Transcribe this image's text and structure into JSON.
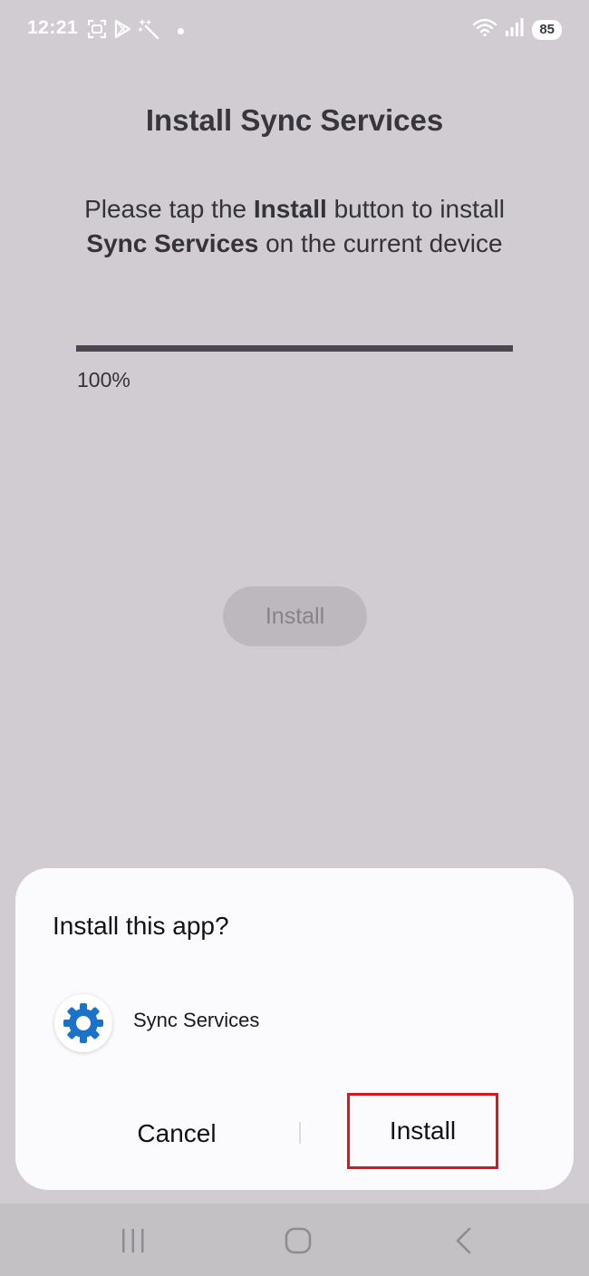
{
  "status_bar": {
    "time": "12:21",
    "battery": "85",
    "icons_left": [
      "screenshot-icon",
      "play-store-icon",
      "magic-wand-icon",
      "dot-icon"
    ],
    "icons_right": [
      "wifi-icon",
      "signal-icon"
    ]
  },
  "page": {
    "title": "Install Sync Services",
    "message_part1": "Please tap the ",
    "message_bold1": "Install",
    "message_part2": " button to install ",
    "message_bold2": "Sync Services",
    "message_part3": " on the current device",
    "progress_percent": 100,
    "progress_text": "100%",
    "install_button_label": "Install"
  },
  "dialog": {
    "title": "Install this app?",
    "app_icon": "gear-icon",
    "app_name": "Sync Services",
    "cancel_label": "Cancel",
    "install_label": "Install",
    "highlight_color": "#e0131d"
  },
  "nav_bar": {
    "buttons": [
      "recents-icon",
      "home-icon",
      "back-icon"
    ]
  }
}
